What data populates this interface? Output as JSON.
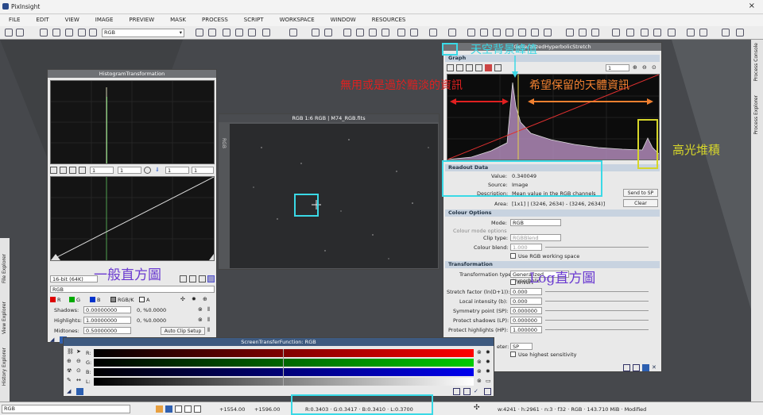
{
  "app": {
    "title": "PixInsight"
  },
  "menu": [
    "FILE",
    "EDIT",
    "VIEW",
    "IMAGE",
    "PREVIEW",
    "MASK",
    "PROCESS",
    "SCRIPT",
    "WORKSPACE",
    "WINDOW",
    "RESOURCES"
  ],
  "toolbar": {
    "view_select": "RGB"
  },
  "histogram": {
    "title": "HistogramTransformation",
    "zoom_h": "1",
    "zoom_v": "1",
    "zoom_h2": "1",
    "zoom_v2": "1",
    "bit_depth": "16-bit (64K)",
    "channel_view": "RGB",
    "channels": [
      "R",
      "G",
      "B",
      "RGB/K",
      "A"
    ],
    "shadows_label": "Shadows:",
    "shadows": "0.00000000",
    "shadows_pct": "0, %0.0000",
    "highlights_label": "Highlights:",
    "highlights": "1.00000000",
    "highlights_pct": "0, %0.0000",
    "midtones_label": "Midtones:",
    "midtones": "0.50000000",
    "autoclip": "Auto Clip Setup"
  },
  "image_window": {
    "title": "RGB 1:6 RGB | M74_RGB.fits",
    "side_label": "RGB"
  },
  "stretch": {
    "title": "GeneralizedHyperbolicStretch",
    "graph_label": "Graph",
    "zoom": "1",
    "readout_label": "Readout Data",
    "value_label": "Value:",
    "value": "0.340049",
    "source_label": "Source:",
    "source": "Image",
    "description_label": "Description:",
    "description": "Mean value in the RGB channels",
    "send_btn": "Send to SP",
    "area_label": "Area:",
    "area": "[1x1] | (3246, 2634) - (3246, 2634)]",
    "clear_btn": "Clear",
    "colour_label": "Colour Options",
    "mode_label": "Mode:",
    "mode": "RGB",
    "colour_mode_opts": "Colour mode options",
    "clip_label": "Clip type:",
    "clip": "RGBBlend",
    "blend_label": "Colour blend:",
    "blend": "1.000",
    "use_rgb": "Use RGB working space",
    "transform_label": "Transformation",
    "ttype_label": "Transformation type:",
    "ttype": "Generalized Hyperbolic",
    "invert": "Invert",
    "params": [
      {
        "label": "Stretch factor (ln(D+1)):",
        "value": "0.000"
      },
      {
        "label": "Local intensity (b):",
        "value": "0.000"
      },
      {
        "label": "Symmetry point (SP):",
        "value": "0.000000"
      },
      {
        "label": "Protect shadows (LP):",
        "value": "0.000000"
      },
      {
        "label": "Protect highlights (HP):",
        "value": "1.000000"
      }
    ],
    "sp_select": "SP",
    "high_sens": "Use highest sensitivity",
    "meter_label": "eter:"
  },
  "stf": {
    "title": "ScreenTransferFunction: RGB",
    "rows": [
      "R:",
      "G:",
      "B:",
      "L:"
    ]
  },
  "status": {
    "view": "RGB",
    "x": "+1554.00",
    "y": "+1596.00",
    "readout": "R:0.3403 · G:0.3417 · B:0.3410 · L:0.3700",
    "info": "w:4241 · h:2961 · n:3 · f32 · RGB · 143.710 MiB · Modified"
  },
  "right_tabs": [
    "Process Console",
    "Process Explorer"
  ],
  "left_tabs": [
    "File Explorer",
    "View Explorer",
    "History Explorer"
  ],
  "annotations": {
    "sky_peak": "天空背景峰值",
    "discard": "無用或是過於黯淡的資訊",
    "keep": "希望保留的天體資訊",
    "highlight": "高光堆積",
    "linear": "一般直方圖",
    "log": "Log直方圖"
  },
  "colors": {
    "annotation_red": "#e02020",
    "annotation_orange": "#f08030",
    "annotation_cyan": "#3ad9e6",
    "annotation_purple": "#6a3ad0",
    "annotation_yellow": "#d6d62a"
  }
}
